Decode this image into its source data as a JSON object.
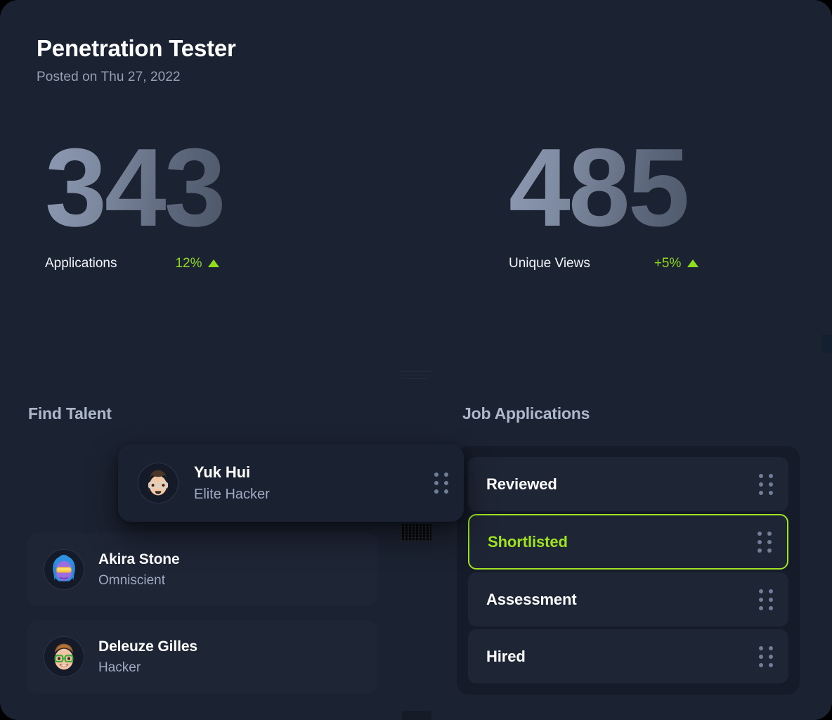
{
  "header": {
    "title": "Penetration Tester",
    "posted": "Posted on Thu 27, 2022"
  },
  "stats": [
    {
      "value": "343",
      "label": "Applications",
      "delta": "12%",
      "delta_direction": "up",
      "delta_color": "#8fdb1e"
    },
    {
      "value": "485",
      "label": "Unique Views",
      "delta": "+5%",
      "delta_direction": "up",
      "delta_color": "#8fdb1e"
    }
  ],
  "find_talent": {
    "heading": "Find Talent",
    "dragging_card": {
      "name": "Yuk Hui",
      "role": "Elite Hacker",
      "avatar": "memoji-glasses-bob-haircut",
      "handle_icon": "drag-handle-icon"
    },
    "items": [
      {
        "name": "Akira Stone",
        "role": "Omniscient",
        "avatar": "memoji-blue-hair-visor"
      },
      {
        "name": "Deleuze Gilles",
        "role": "Hacker",
        "avatar": "memoji-green-glasses"
      }
    ]
  },
  "job_applications": {
    "heading": "Job Applications",
    "active_label": "Shortlisted",
    "active_color": "#9fe322",
    "items": [
      {
        "label": "Reviewed",
        "active": false,
        "handle_icon": "drag-handle-icon"
      },
      {
        "label": "Shortlisted",
        "active": true,
        "handle_icon": "drag-handle-icon"
      },
      {
        "label": "Assessment",
        "active": false,
        "handle_icon": "drag-handle-icon"
      },
      {
        "label": "Hired",
        "active": false,
        "handle_icon": "drag-handle-icon"
      }
    ]
  },
  "theme": {
    "background": "#1b2231",
    "card": "#1e2535",
    "panel": "#151b28",
    "accent": "#9fe322",
    "text_primary": "#ffffff",
    "text_muted": "#9fabc2"
  }
}
